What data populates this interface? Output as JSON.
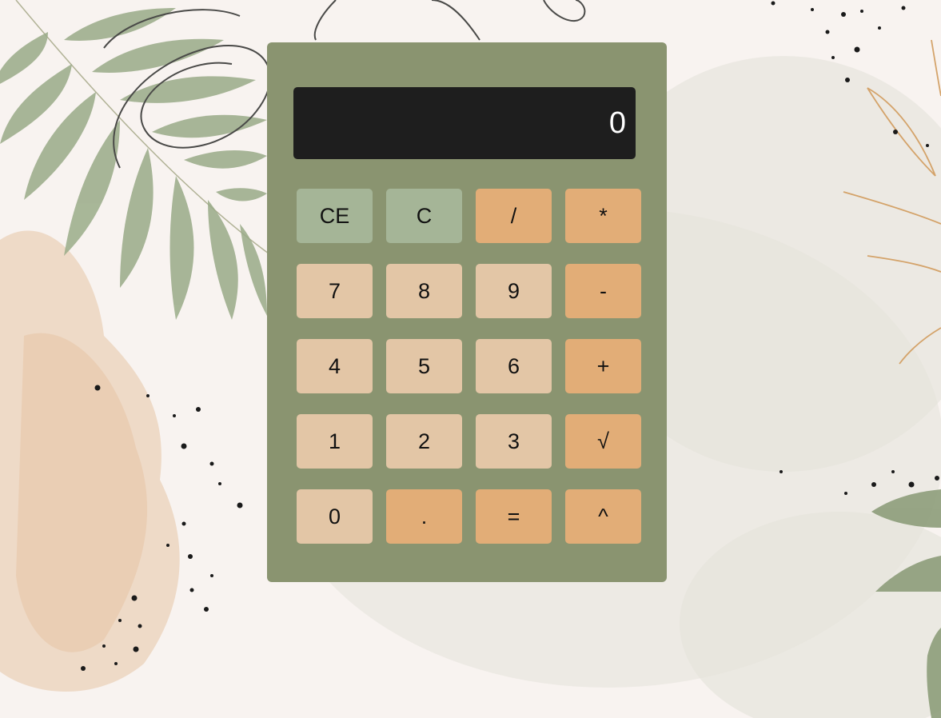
{
  "colors": {
    "page_background": "#f8f3f0",
    "calculator_body": "#8a9470",
    "display_background": "#1e1e1e",
    "display_text": "#ffffff",
    "function_key": "#a5b597",
    "operator_key": "#e2ad77",
    "number_key": "#e3c6a6"
  },
  "calculator": {
    "display_value": "0",
    "keys": [
      {
        "label": "CE",
        "type": "function",
        "name": "clear-entry-button"
      },
      {
        "label": "C",
        "type": "function",
        "name": "clear-button"
      },
      {
        "label": "/",
        "type": "operator",
        "name": "divide-button"
      },
      {
        "label": "*",
        "type": "operator",
        "name": "multiply-button"
      },
      {
        "label": "7",
        "type": "number",
        "name": "digit-7-button"
      },
      {
        "label": "8",
        "type": "number",
        "name": "digit-8-button"
      },
      {
        "label": "9",
        "type": "number",
        "name": "digit-9-button"
      },
      {
        "label": "-",
        "type": "operator",
        "name": "subtract-button"
      },
      {
        "label": "4",
        "type": "number",
        "name": "digit-4-button"
      },
      {
        "label": "5",
        "type": "number",
        "name": "digit-5-button"
      },
      {
        "label": "6",
        "type": "number",
        "name": "digit-6-button"
      },
      {
        "label": "+",
        "type": "operator",
        "name": "add-button"
      },
      {
        "label": "1",
        "type": "number",
        "name": "digit-1-button"
      },
      {
        "label": "2",
        "type": "number",
        "name": "digit-2-button"
      },
      {
        "label": "3",
        "type": "number",
        "name": "digit-3-button"
      },
      {
        "label": "√",
        "type": "operator",
        "name": "square-root-button"
      },
      {
        "label": "0",
        "type": "number",
        "name": "digit-0-button"
      },
      {
        "label": ".",
        "type": "operator",
        "name": "decimal-button"
      },
      {
        "label": "=",
        "type": "operator",
        "name": "equals-button"
      },
      {
        "label": "^",
        "type": "operator",
        "name": "power-button"
      }
    ]
  }
}
